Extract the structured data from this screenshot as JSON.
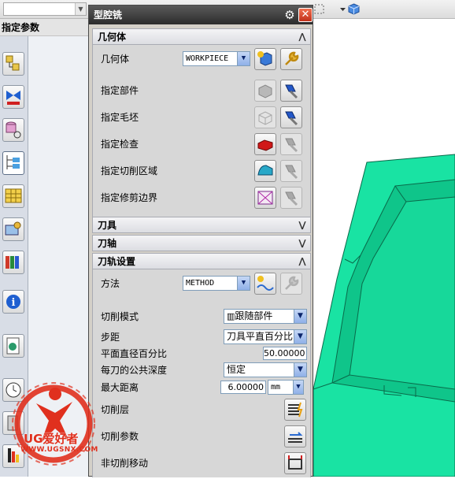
{
  "dialog": {
    "title": "型腔铣"
  },
  "navigator": {
    "title": "指定参数"
  },
  "sections": {
    "geometry": {
      "header": "几何体",
      "geometry_label": "几何体",
      "geometry_value": "WORKPIECE",
      "specify_part": "指定部件",
      "specify_blank": "指定毛坯",
      "specify_check": "指定检查",
      "specify_cut_area": "指定切削区域",
      "specify_trim_boundary": "指定修剪边界"
    },
    "tool": {
      "header": "刀具"
    },
    "tool_axis": {
      "header": "刀轴"
    },
    "path_settings": {
      "header": "刀轨设置",
      "method_label": "方法",
      "method_value": "METHOD",
      "cut_pattern_label": "切削模式",
      "cut_pattern_value": "跟随部件",
      "stepover_label": "步距",
      "stepover_value": "刀具平直百分比",
      "percent_flat_label": "平面直径百分比",
      "percent_flat_value": "50.00000",
      "depth_per_cut_label": "每刀的公共深度",
      "depth_per_cut_value": "恒定",
      "max_distance_label": "最大距离",
      "max_distance_value": "6.00000",
      "max_distance_unit": "mm",
      "cut_levels_label": "切削层",
      "cutting_params_label": "切削参数",
      "non_cutting_label": "非切削移动"
    }
  },
  "logo": {
    "brand": "UG爱好者",
    "url": "WWW.UGSNX.COM"
  },
  "colors": {
    "part_green": "#19e3a3",
    "title_dark": "#3a3a3a",
    "logo_red": "#e0301e"
  }
}
